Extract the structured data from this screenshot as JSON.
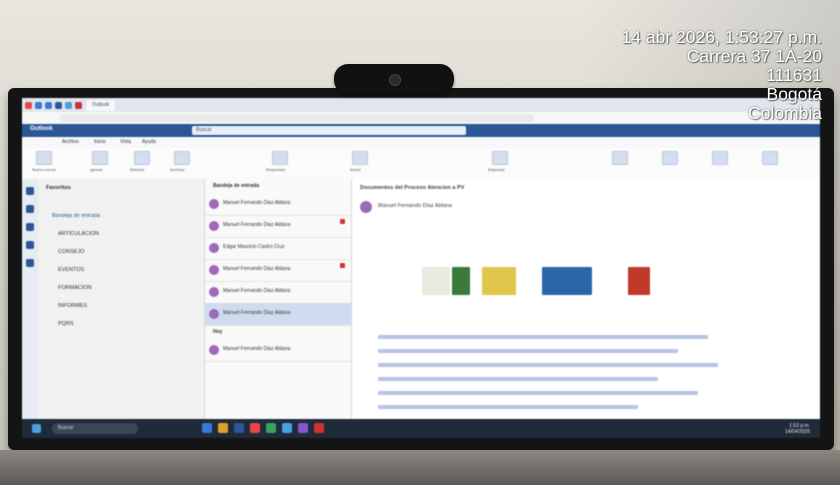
{
  "overlay": {
    "datetime": "14 abr 2026, 1:53:27 p.m.",
    "address": "Carrera 37 1A-20",
    "code": "111631",
    "city": "Bogotá",
    "country": "Colombia"
  },
  "colors": {
    "outlook_blue": "#2b5797",
    "taskbar": "#1f2a3a"
  },
  "screen": {
    "app_title": "Outlook",
    "search_placeholder": "Buscar",
    "ribbon_tabs": [
      "Archivo",
      "Inicio",
      "Vista",
      "Ayuda"
    ],
    "ribbon_labels": [
      "Nuevo correo",
      "Ignorar",
      "Eliminar",
      "Archivar",
      "Responder",
      "Mover",
      "Etiquetas"
    ],
    "folders_title": "Favoritos",
    "folders": [
      "Bandeja de entrada",
      "ARTICULACION",
      "CONSEJO",
      "EVENTOS",
      "FORMACION",
      "INFORMES",
      "PQRS"
    ],
    "list_title": "Bandeja de entrada",
    "list_section": "Hoy",
    "messages": [
      "Manuel Fernando Diaz Aldana",
      "Manuel Fernando Diaz Aldana",
      "Edgar Mauricio Castro Cruz",
      "Manuel Fernando Diaz Aldana",
      "Manuel Fernando Diaz Aldana",
      "Manuel Fernando Diaz Aldana",
      "Manuel Fernando Diaz Aldana"
    ],
    "reading_subject": "Documentos del Proceso Atencion a PV",
    "reading_sender": "Manuel Fernando Diaz Aldana",
    "search_box_text": "Buscar",
    "taskbar_search": "Buscar",
    "clock_time": "1:53 p.m.",
    "clock_date": "14/04/2026"
  }
}
